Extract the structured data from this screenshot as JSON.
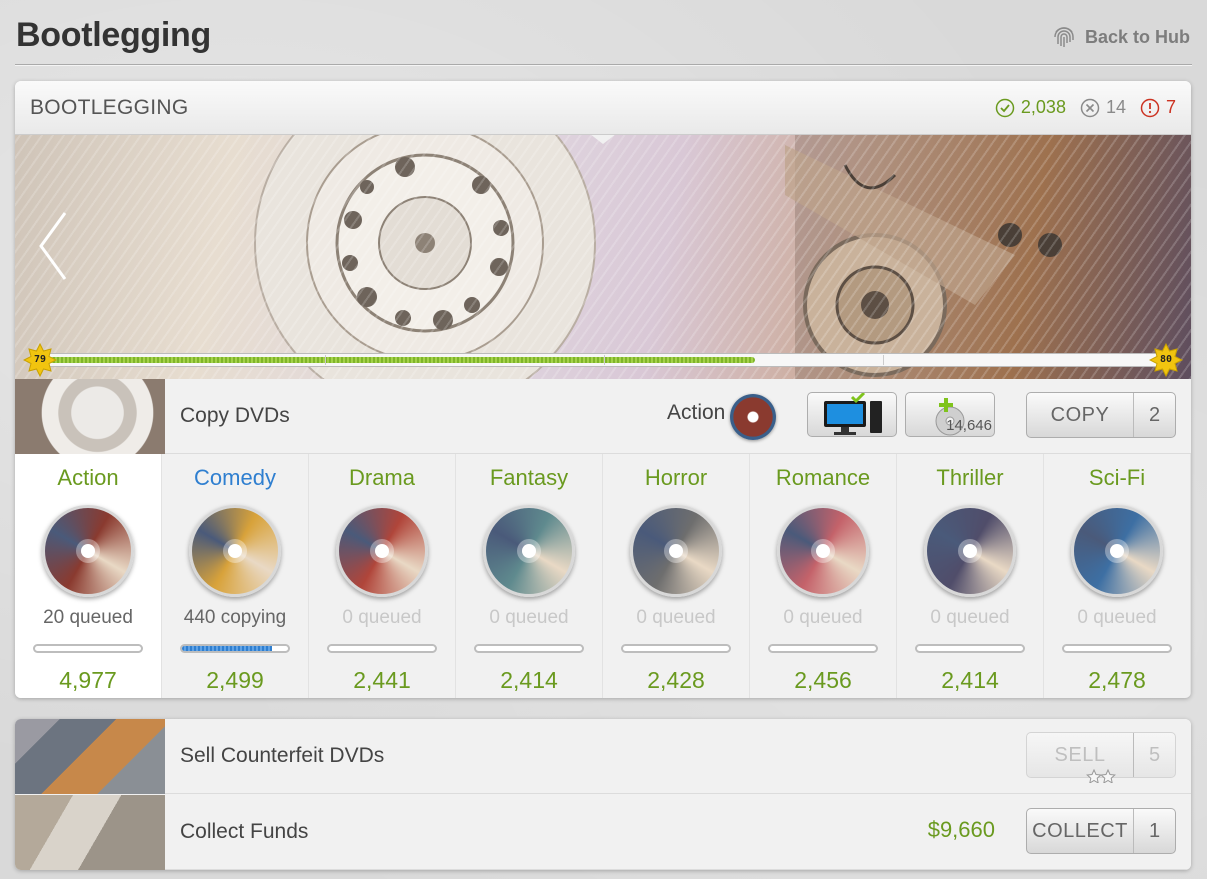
{
  "page": {
    "title": "Bootlegging",
    "back_label": "Back to Hub"
  },
  "panel": {
    "title": "BOOTLEGGING",
    "stats": {
      "completed": "2,038",
      "failed": "14",
      "warnings": "7"
    }
  },
  "progress": {
    "level_current": "79",
    "level_next": "80",
    "fraction": 0.63
  },
  "copy_row": {
    "label": "Copy DVDs",
    "genre": "Action",
    "blank_dvds": "14,646",
    "button": "COPY",
    "button_count": "2"
  },
  "genres": [
    {
      "name": "Action",
      "status": "20 queued",
      "count": "4,977",
      "progress": 0,
      "name_color": "#6a9a1f",
      "selected": true,
      "disc": "#8a3a2f"
    },
    {
      "name": "Comedy",
      "status": "440 copying",
      "count": "2,499",
      "progress": 0.85,
      "name_color": "#2f7fd0",
      "selected": false,
      "disc": "#d8a23a"
    },
    {
      "name": "Drama",
      "status": "0 queued",
      "count": "2,441",
      "progress": 0,
      "name_color": "#6a9a1f",
      "selected": false,
      "disc": "#b0453a"
    },
    {
      "name": "Fantasy",
      "status": "0 queued",
      "count": "2,414",
      "progress": 0,
      "name_color": "#6a9a1f",
      "selected": false,
      "disc": "#5f8a8e"
    },
    {
      "name": "Horror",
      "status": "0 queued",
      "count": "2,428",
      "progress": 0,
      "name_color": "#6a9a1f",
      "selected": false,
      "disc": "#6e6e6e"
    },
    {
      "name": "Romance",
      "status": "0 queued",
      "count": "2,456",
      "progress": 0,
      "name_color": "#6a9a1f",
      "selected": false,
      "disc": "#c4626a"
    },
    {
      "name": "Thriller",
      "status": "0 queued",
      "count": "2,414",
      "progress": 0,
      "name_color": "#6a9a1f",
      "selected": false,
      "disc": "#504d6a"
    },
    {
      "name": "Sci-Fi",
      "status": "0 queued",
      "count": "2,478",
      "progress": 0,
      "name_color": "#6a9a1f",
      "selected": false,
      "disc": "#3d6fa3"
    }
  ],
  "sell_row": {
    "label": "Sell Counterfeit DVDs",
    "button": "SELL",
    "button_count": "5"
  },
  "collect_row": {
    "label": "Collect Funds",
    "amount": "$9,660",
    "button": "COLLECT",
    "button_count": "1"
  }
}
